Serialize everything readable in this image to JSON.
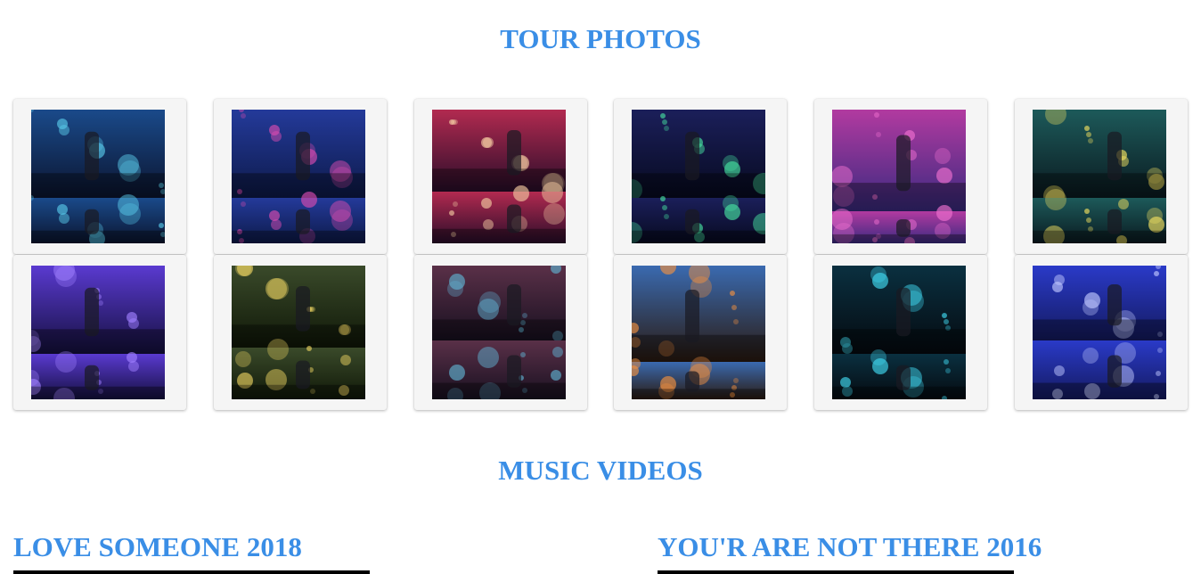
{
  "tour_photos": {
    "title": "TOUR PHOTOS",
    "photos": [
      {
        "name": "tour-photo-1",
        "c1": "#1a4a8a",
        "c2": "#0b1530",
        "accent": "#57c7e8",
        "split": 0.66
      },
      {
        "name": "tour-photo-2",
        "c1": "#243a9a",
        "c2": "#0d1a4a",
        "accent": "#d84bb0",
        "split": 0.66
      },
      {
        "name": "tour-photo-3",
        "c1": "#b22a50",
        "c2": "#2a0d2a",
        "accent": "#f2c8a0",
        "split": 0.61
      },
      {
        "name": "tour-photo-4",
        "c1": "#1b1f5a",
        "c2": "#070a20",
        "accent": "#46e0a0",
        "split": 0.66
      },
      {
        "name": "tour-photo-5",
        "c1": "#b23aa0",
        "c2": "#3a2a80",
        "accent": "#f070d0",
        "split": 0.76
      },
      {
        "name": "tour-photo-6",
        "c1": "#1d5a5a",
        "c2": "#0a1a20",
        "accent": "#f2e060",
        "split": 0.66
      },
      {
        "name": "tour-photo-7",
        "c1": "#5a3ad0",
        "c2": "#151040",
        "accent": "#a080ff",
        "split": 0.66
      },
      {
        "name": "tour-photo-8",
        "c1": "#3a4a2a",
        "c2": "#101808",
        "accent": "#e8d060",
        "split": 0.61
      },
      {
        "name": "tour-photo-9",
        "c1": "#5a3048",
        "c2": "#181020",
        "accent": "#60b0d0",
        "split": 0.56
      },
      {
        "name": "tour-photo-10",
        "c1": "#3a6ab0",
        "c2": "#2a1a10",
        "accent": "#f09040",
        "split": 0.72
      },
      {
        "name": "tour-photo-11",
        "c1": "#0a3040",
        "c2": "#050a10",
        "accent": "#40d8f0",
        "split": 0.66
      },
      {
        "name": "tour-photo-12",
        "c1": "#2a3ac8",
        "c2": "#141a60",
        "accent": "#c0c8ff",
        "split": 0.56
      }
    ]
  },
  "music_videos": {
    "title": "MUSIC VIDEOS",
    "videos": [
      {
        "title": "LOVE SOMEONE 2018"
      },
      {
        "title": "YOU'R ARE NOT THERE 2016"
      }
    ]
  },
  "colors": {
    "heading": "#3a8ee6",
    "card_background": "#f5f5f5",
    "video_frame": "#000000"
  }
}
